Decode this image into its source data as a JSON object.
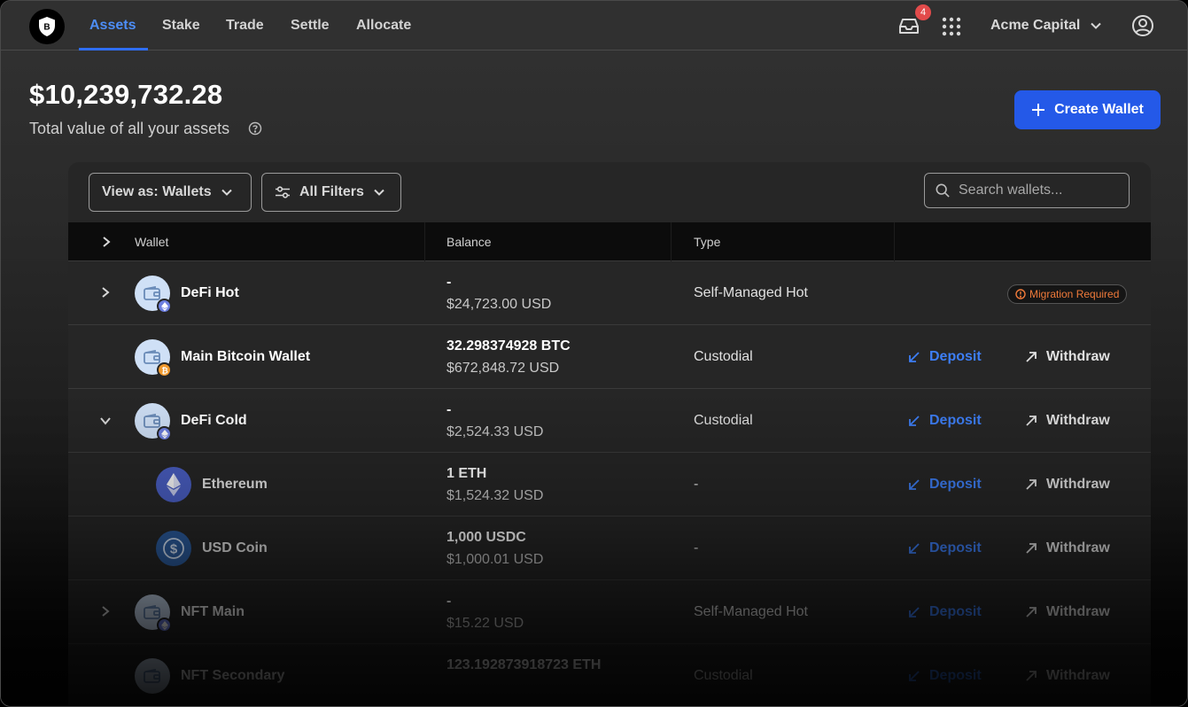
{
  "nav": {
    "tabs": [
      {
        "label": "Assets"
      },
      {
        "label": "Stake"
      },
      {
        "label": "Trade"
      },
      {
        "label": "Settle"
      },
      {
        "label": "Allocate"
      }
    ],
    "notification_count": "4",
    "org_name": "Acme Capital"
  },
  "header": {
    "total_value": "$10,239,732.28",
    "subtitle": "Total value of all your assets",
    "create_label": "Create Wallet"
  },
  "controls": {
    "view_as": "View as: Wallets",
    "filters": "All Filters",
    "search_placeholder": "Search wallets..."
  },
  "table": {
    "columns": [
      "Wallet",
      "Balance",
      "Type"
    ],
    "deposit_label": "Deposit",
    "withdraw_label": "Withdraw",
    "migration_label": "Migration Required",
    "rows": [
      {
        "name": "DeFi Hot",
        "bal1": "-",
        "bal2": "$24,723.00 USD",
        "type": "Self-Managed Hot",
        "chain": "eth"
      },
      {
        "name": "Main Bitcoin Wallet",
        "bal1": "32.298374928 BTC",
        "bal2": "$672,848.72 USD",
        "type": "Custodial",
        "chain": "btc"
      },
      {
        "name": "DeFi Cold",
        "bal1": "-",
        "bal2": "$2,524.33 USD",
        "type": "Custodial",
        "chain": "eth"
      },
      {
        "name": "Ethereum",
        "bal1": "1 ETH",
        "bal2": "$1,524.32 USD",
        "type": "-"
      },
      {
        "name": "USD Coin",
        "bal1": "1,000 USDC",
        "bal2": "$1,000.01 USD",
        "type": "-"
      },
      {
        "name": "NFT Main",
        "bal1": "-",
        "bal2": "$15.22 USD",
        "type": "Self-Managed Hot",
        "chain": "eth"
      },
      {
        "name": "NFT Secondary",
        "bal1": "123.192873918723 ETH",
        "bal2": "",
        "type": "Custodial",
        "chain": "eth"
      }
    ]
  },
  "colors": {
    "accent": "#2459e8",
    "link": "#3d7ef5",
    "warning": "#ef7a3a",
    "badge": "#e24b4b"
  }
}
